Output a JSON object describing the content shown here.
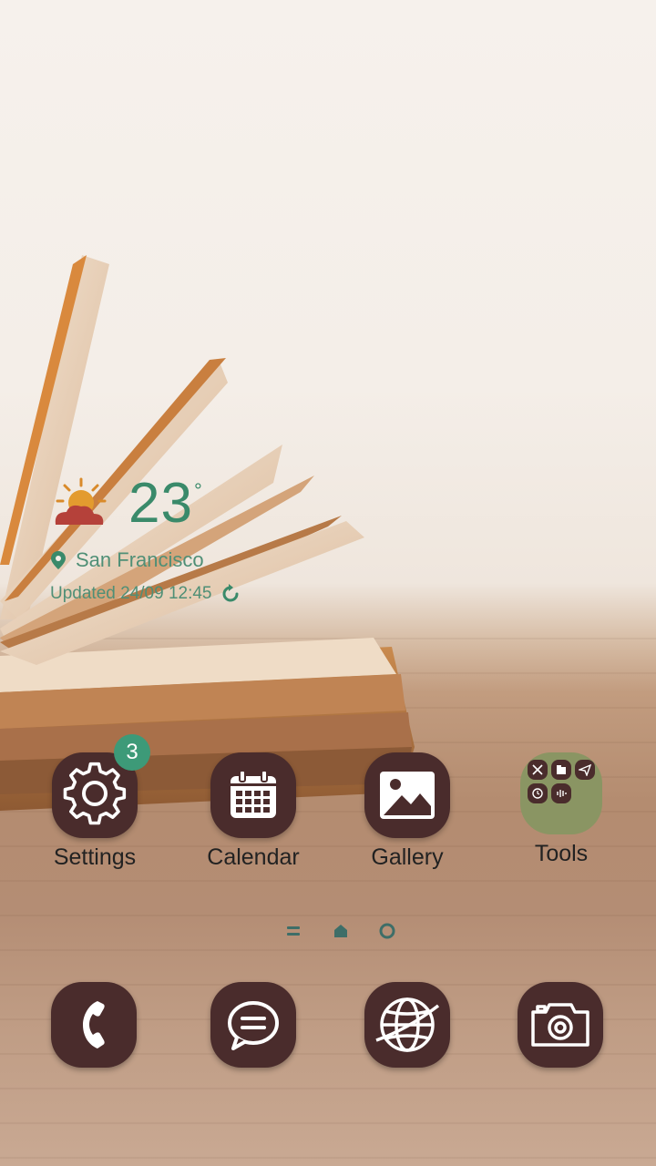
{
  "weather": {
    "temperature": "23",
    "unit": "°",
    "location": "San Francisco",
    "updated": "Updated 24/09 12:45",
    "icon": "partly-cloudy-sun-icon"
  },
  "apps": [
    {
      "label": "Settings",
      "icon": "gear-icon",
      "badge": "3"
    },
    {
      "label": "Calendar",
      "icon": "calendar-icon"
    },
    {
      "label": "Gallery",
      "icon": "image-icon"
    },
    {
      "label": "Tools",
      "icon": "folder-icon"
    }
  ],
  "dock": [
    {
      "icon": "phone-icon"
    },
    {
      "icon": "message-icon"
    },
    {
      "icon": "globe-icon"
    },
    {
      "icon": "camera-icon"
    }
  ],
  "colors": {
    "icon_bg": "#4a2c2c",
    "accent": "#3d9a78",
    "folder_bg": "#8a9563"
  }
}
